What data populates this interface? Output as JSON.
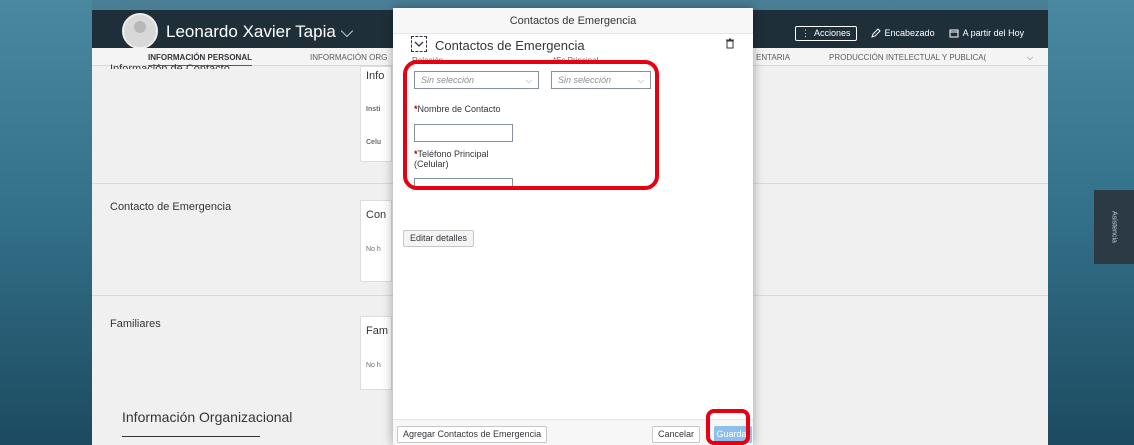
{
  "header": {
    "person_name": "Leonardo Xavier Tapia ⌵",
    "actions_label": "Acciones",
    "encabezado_label": "Encabezado",
    "fecha_label": "A partir del Hoy"
  },
  "tabs": [
    {
      "label": "INFORMACIÓN PERSONAL",
      "active": true
    },
    {
      "label": "INFORMACIÓN ORG"
    },
    {
      "label": "ENTARIA"
    },
    {
      "label": "PRODUCCIÓN INTELECTUAL Y PUBLICA("
    }
  ],
  "background": {
    "contact_info_label": "Información de Contacto",
    "contact_card_title": "Info",
    "contact_card_inst": "Insti",
    "contact_card_cel": "Celu",
    "emergency_label": "Contacto de Emergencia",
    "emergency_card_title": "Con",
    "emergency_card_note": "No h",
    "familiares_label": "Familiares",
    "familiares_card_title": "Fam",
    "familiares_card_note": "No h",
    "org_heading": "Información Organizacional",
    "side_handle": "Asistencia"
  },
  "dialog": {
    "title": "Contactos de Emergencia",
    "section_title": "Contactos de Emergencia",
    "relacion_label": "Relación",
    "es_principal_label": "*Es Principal",
    "relacion_value": "Sin selección",
    "es_principal_value": "Sin selección",
    "nombre_label": "Nombre de Contacto",
    "telefono_label_line1": "Teléfono Principal",
    "telefono_label_line2": "(Celular)",
    "edit_details": "Editar detalles",
    "add_button": "Agregar Contactos de Emergencia",
    "cancel_button": "Cancelar",
    "save_button": "Guardar"
  },
  "colors": {
    "highlight": "#e60012",
    "accent": "#0a6ed1",
    "required": "#bb0000"
  }
}
